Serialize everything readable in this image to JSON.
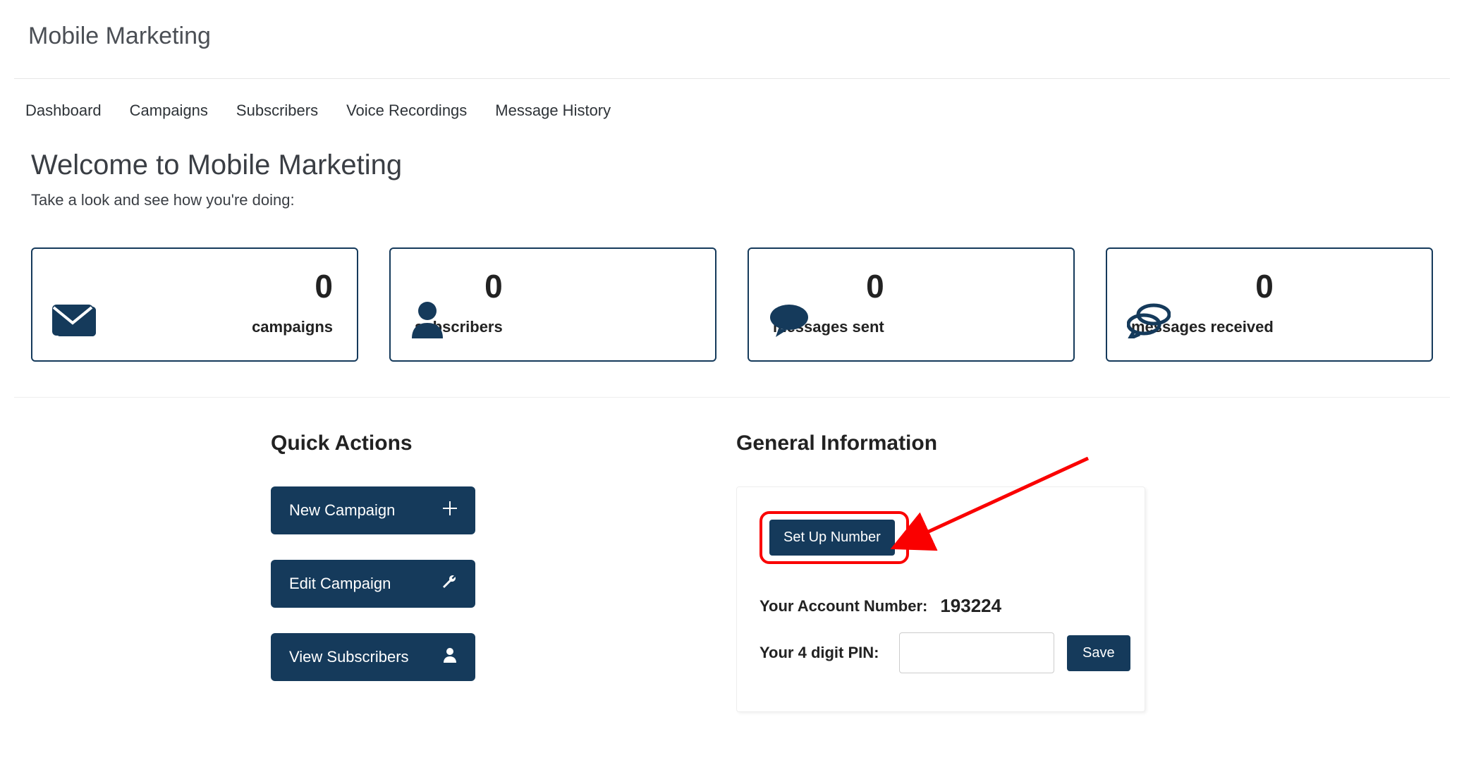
{
  "header": {
    "title": "Mobile Marketing"
  },
  "nav": {
    "items": [
      {
        "label": "Dashboard"
      },
      {
        "label": "Campaigns"
      },
      {
        "label": "Subscribers"
      },
      {
        "label": "Voice Recordings"
      },
      {
        "label": "Message History"
      }
    ]
  },
  "welcome": {
    "heading": "Welcome to Mobile Marketing",
    "subheading": "Take a look and see how you're doing:"
  },
  "stats": [
    {
      "value": "0",
      "label": "campaigns"
    },
    {
      "value": "0",
      "label": "subscribers"
    },
    {
      "value": "0",
      "label": "messages sent"
    },
    {
      "value": "0",
      "label": "messages received"
    }
  ],
  "quick_actions": {
    "heading": "Quick Actions",
    "items": [
      {
        "label": "New Campaign"
      },
      {
        "label": "Edit Campaign"
      },
      {
        "label": "View Subscribers"
      }
    ]
  },
  "general_info": {
    "heading": "General Information",
    "setup_label": "Set Up Number",
    "account_label": "Your Account Number:",
    "account_value": "193224",
    "pin_label": "Your 4 digit PIN:",
    "pin_value": "",
    "save_label": "Save"
  }
}
